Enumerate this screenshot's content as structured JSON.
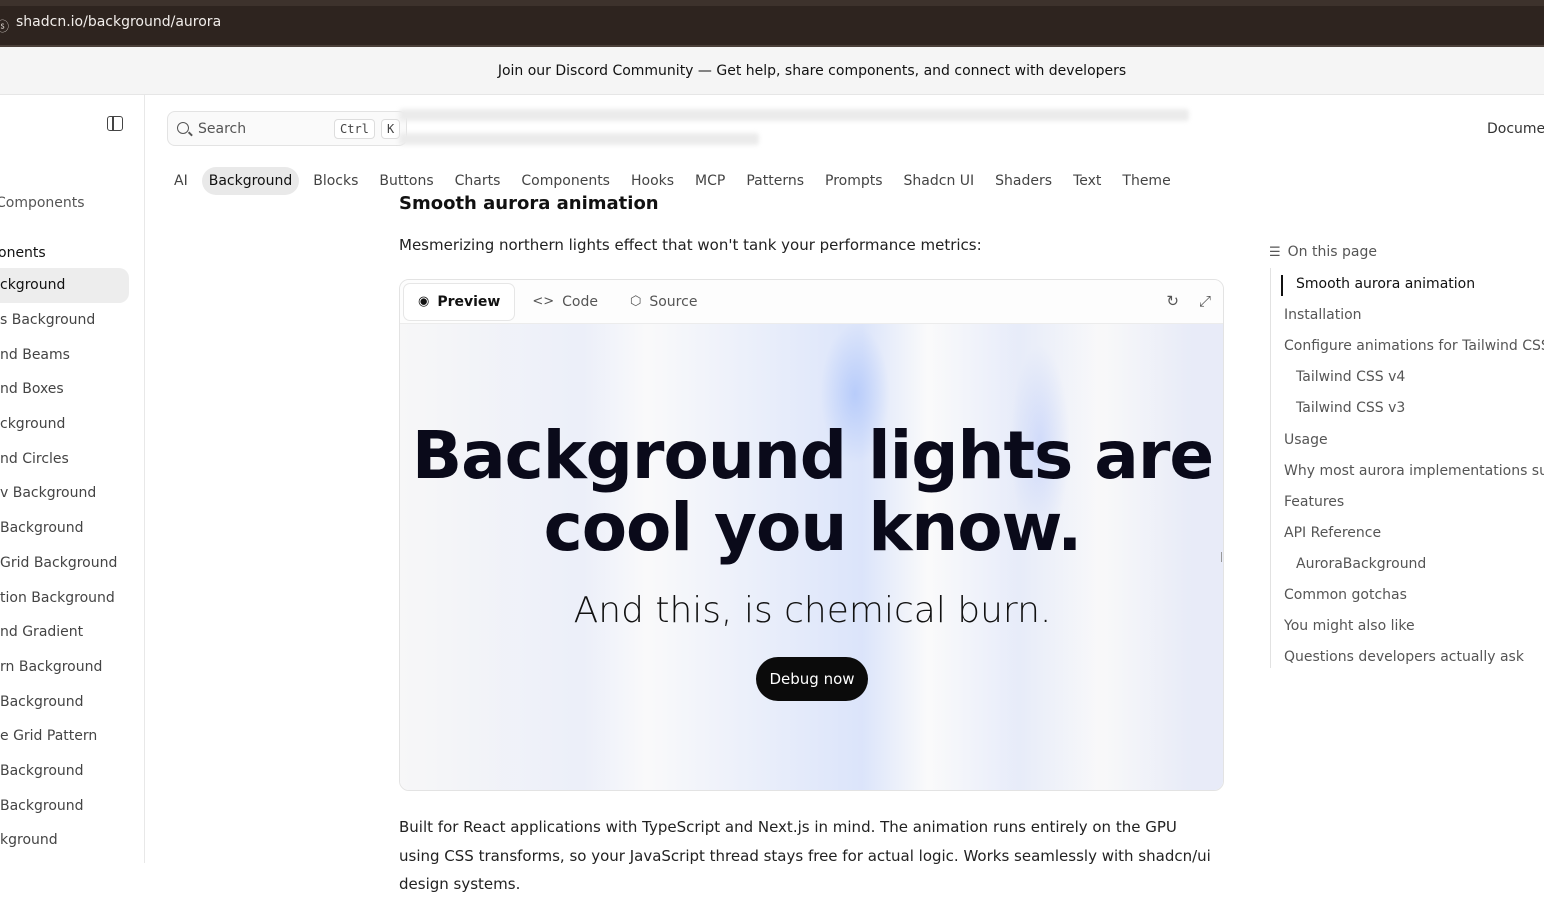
{
  "browser": {
    "url": "shadcn.io/background/aurora"
  },
  "banner": {
    "text": "Join our Discord Community — Get help, share components, and connect with developers"
  },
  "sidebar": {
    "group_top": "Components",
    "group_head": "Components",
    "items": [
      {
        "label": "Background"
      },
      {
        "label": "Background Beams"
      },
      {
        "label": "Background Beams"
      },
      {
        "label": "Background Boxes"
      },
      {
        "label": "Background"
      },
      {
        "label": "Background Circles"
      },
      {
        "label": "Glow Background"
      },
      {
        "label": "Background"
      },
      {
        "label": "Dot Grid Background"
      },
      {
        "label": "Animation Background"
      },
      {
        "label": "Background Gradient"
      },
      {
        "label": "Pattern Background"
      },
      {
        "label": "Background"
      },
      {
        "label": "Line Grid Pattern"
      },
      {
        "label": "Background"
      },
      {
        "label": "Background"
      },
      {
        "label": "Background"
      }
    ],
    "visible": [
      "ckground",
      "s Background",
      "nd Beams",
      "nd Boxes",
      "ckground",
      "nd Circles",
      "v Background",
      " Background",
      " Grid Background",
      "tion Background",
      "nd Gradient",
      "rn Background",
      "Background",
      "e Grid Pattern",
      "Background",
      "Background",
      "kground"
    ],
    "group_top_visible": "Components",
    "group_head_visible": "onents"
  },
  "search": {
    "placeholder": "Search",
    "key_ctrl": "Ctrl",
    "key_k": "K"
  },
  "header": {
    "docs_link": "Documer"
  },
  "categories": [
    "AI",
    "Background",
    "Blocks",
    "Buttons",
    "Charts",
    "Components",
    "Hooks",
    "MCP",
    "Patterns",
    "Prompts",
    "Shadcn UI",
    "Shaders",
    "Text",
    "Theme"
  ],
  "main": {
    "heading": "Smooth aurora animation",
    "lead": "Mesmerizing northern lights effect that won't tank your performance metrics:",
    "tabs": {
      "preview": "Preview",
      "code": "Code",
      "source": "Source"
    },
    "demo": {
      "headline_line1": "Background lights are",
      "headline_line2": "cool you know.",
      "subtext": "And this, is chemical burn.",
      "cta": "Debug now"
    },
    "body": "Built for React applications with TypeScript and Next.js in mind. The animation runs entirely on the GPU using CSS transforms, so your JavaScript thread stays free for actual logic. Works seamlessly with shadcn/ui design systems."
  },
  "toc": {
    "title": "On this page",
    "items": [
      {
        "label": "Smooth aurora animation",
        "level": 2,
        "active": true
      },
      {
        "label": "Installation",
        "level": 1
      },
      {
        "label": "Configure animations for Tailwind CSS",
        "level": 1
      },
      {
        "label": "Tailwind CSS v4",
        "level": 2
      },
      {
        "label": "Tailwind CSS v3",
        "level": 2
      },
      {
        "label": "Usage",
        "level": 1
      },
      {
        "label": "Why most aurora implementations suck",
        "level": 1
      },
      {
        "label": "Features",
        "level": 1
      },
      {
        "label": "API Reference",
        "level": 1
      },
      {
        "label": "AuroraBackground",
        "level": 2
      },
      {
        "label": "Common gotchas",
        "level": 1
      },
      {
        "label": "You might also like",
        "level": 1
      },
      {
        "label": "Questions developers actually ask",
        "level": 1
      }
    ]
  },
  "colors": {
    "url_bar": "#2e241f",
    "banner_bg": "#f5f5f5",
    "cta_bg": "#0b0b0b",
    "active_pill": "#e9e9e9"
  }
}
